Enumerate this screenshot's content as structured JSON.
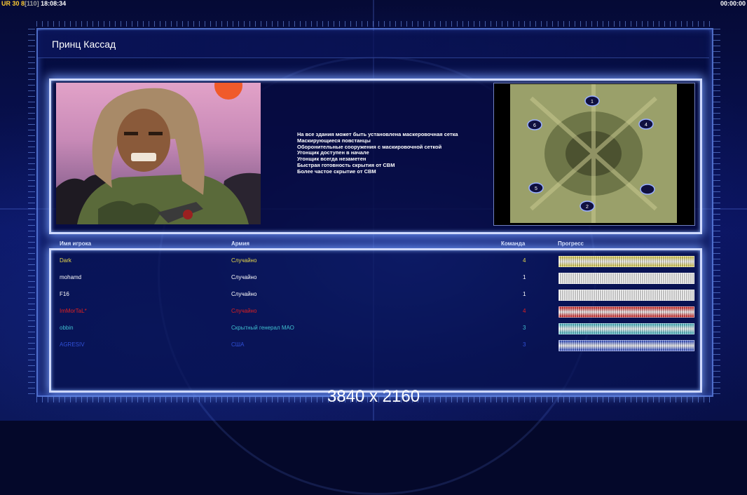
{
  "hud": {
    "left_ur": "UR",
    "left_fps": "30 8",
    "left_extra": "[110]",
    "left_clock": "18:08:34",
    "right_timer": "00:00:00"
  },
  "title": "Принц Кассад",
  "rules": [
    "На все здания может быть установлена маскеровочная сетка",
    "Маскирующиеся повстанцы",
    "Оборонительные сооружения с маскировочной сеткой",
    "Угонщик доступен в начале",
    "Угонщик всегда незаметен",
    "Быстрая готовность скрытия от СВМ",
    "Более частое скрытие от СВМ"
  ],
  "minimap": {
    "start_positions": [
      "1",
      "4",
      "2",
      "5",
      "6"
    ]
  },
  "table": {
    "headers": {
      "player": "Имя игрока",
      "army": "Армия",
      "team": "Команда",
      "progress": "Прогресс"
    },
    "players": [
      {
        "name": "Dark",
        "army": "Случайно",
        "team": "4",
        "color": "#e8d84a",
        "progress": 1.0
      },
      {
        "name": "mohamd",
        "army": "Случайно",
        "team": "1",
        "color": "#ffffff",
        "progress": 1.0
      },
      {
        "name": "F16",
        "army": "Случайно",
        "team": "1",
        "color": "#ffffff",
        "progress": 1.0
      },
      {
        "name": "ImMorTaL*",
        "army": "Случайно",
        "team": "4",
        "color": "#e02020",
        "progress": 1.0
      },
      {
        "name": "obbin",
        "army": "Скрытный генерал МАО",
        "team": "3",
        "color": "#40c0d0",
        "progress": 1.0
      },
      {
        "name": "AGRESIV",
        "army": "США",
        "team": "3",
        "color": "#3050d8",
        "progress": 1.0
      }
    ]
  },
  "watermark": "3840 x 2160"
}
